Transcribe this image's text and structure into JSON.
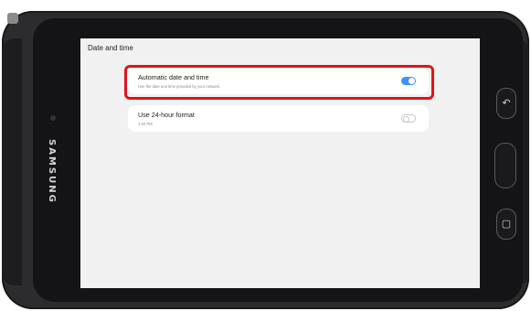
{
  "device": {
    "brand": "SAMSUNG",
    "buttons": [
      "back-icon",
      "home-button",
      "recents-icon"
    ]
  },
  "screen": {
    "page_title": "Date and time",
    "settings": [
      {
        "title": "Automatic date and time",
        "subtitle": "Use the date and time provided by your network.",
        "enabled": true
      },
      {
        "title": "Use 24-hour format",
        "subtitle": "1:00 PM",
        "enabled": false
      }
    ]
  },
  "colors": {
    "toggle_on": "#3e91ff",
    "highlight": "#e0141b",
    "background": "#f1f1f1"
  }
}
